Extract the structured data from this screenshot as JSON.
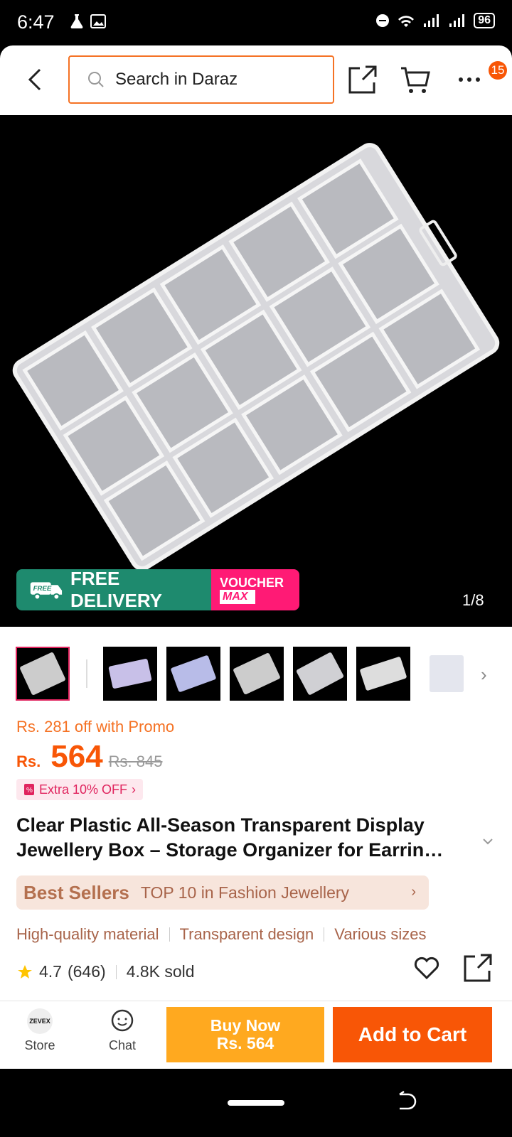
{
  "status": {
    "time": "6:47",
    "battery": "96"
  },
  "header": {
    "search_placeholder": "Search in Daraz",
    "cart_badge": "15"
  },
  "hero": {
    "promo_free": "FREE DELIVERY",
    "promo_free_tag": "FREE",
    "voucher_top": "VOUCHER",
    "voucher_bottom": "MAX",
    "counter": "1/8"
  },
  "product": {
    "promo_line": "Rs. 281 off with Promo",
    "currency": "Rs.",
    "price": "564",
    "old_price": "Rs. 845",
    "extra_off": "Extra 10% OFF",
    "title": "Clear Plastic All-Season Transparent Display Jewellery Box – Storage Organizer for Earrin…",
    "bestseller_label": "Best Sellers",
    "bestseller_text": "TOP 10 in Fashion Jewellery",
    "features": [
      "High-quality material",
      "Transparent design",
      "Various sizes"
    ],
    "rating": "4.7",
    "reviews": "(646)",
    "sold": "4.8K sold"
  },
  "bottom": {
    "store_label": "Store",
    "store_logo": "ZEVEX",
    "chat_label": "Chat",
    "buy_now_line1": "Buy Now",
    "buy_now_line2": "Rs. 564",
    "add_to_cart": "Add to Cart"
  },
  "colors": {
    "accent": "#f85606",
    "buy_now": "#ffa91f"
  }
}
